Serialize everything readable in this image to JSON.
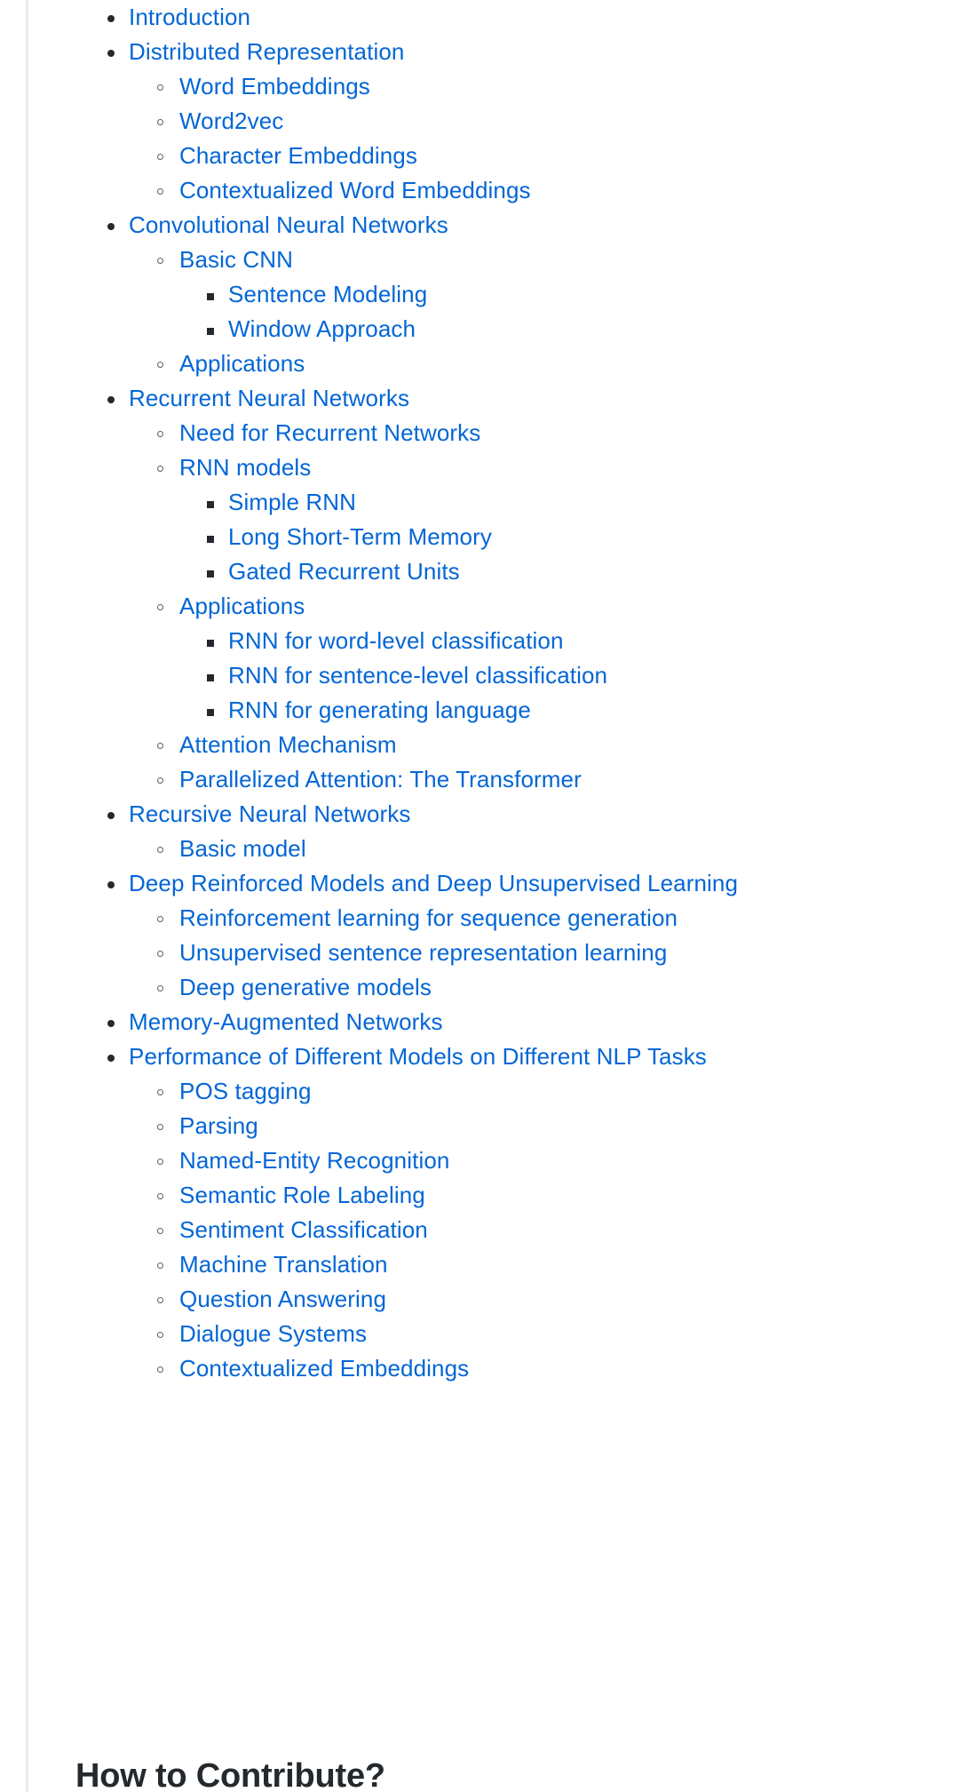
{
  "page": {
    "background_color": "#ffffff",
    "link_color": "#0366d6",
    "heading_color": "#24292e",
    "rule_color": "#eaecef"
  },
  "toc": {
    "items": [
      {
        "level": 1,
        "label": "Introduction",
        "bullet": "disc-bullet-icon"
      },
      {
        "level": 1,
        "label": "Distributed Representation",
        "bullet": "disc-bullet-icon"
      },
      {
        "level": 2,
        "label": "Word Embeddings",
        "bullet": "circle-bullet-icon"
      },
      {
        "level": 2,
        "label": "Word2vec",
        "bullet": "circle-bullet-icon"
      },
      {
        "level": 2,
        "label": "Character Embeddings",
        "bullet": "circle-bullet-icon"
      },
      {
        "level": 2,
        "label": "Contextualized Word Embeddings",
        "bullet": "circle-bullet-icon"
      },
      {
        "level": 1,
        "label": "Convolutional Neural Networks",
        "bullet": "disc-bullet-icon"
      },
      {
        "level": 2,
        "label": "Basic CNN",
        "bullet": "circle-bullet-icon"
      },
      {
        "level": 3,
        "label": "Sentence Modeling",
        "bullet": "square-bullet-icon"
      },
      {
        "level": 3,
        "label": "Window Approach",
        "bullet": "square-bullet-icon"
      },
      {
        "level": 2,
        "label": "Applications",
        "bullet": "circle-bullet-icon"
      },
      {
        "level": 1,
        "label": "Recurrent Neural Networks",
        "bullet": "disc-bullet-icon"
      },
      {
        "level": 2,
        "label": "Need for Recurrent Networks",
        "bullet": "circle-bullet-icon"
      },
      {
        "level": 2,
        "label": "RNN models",
        "bullet": "circle-bullet-icon"
      },
      {
        "level": 3,
        "label": "Simple RNN",
        "bullet": "square-bullet-icon"
      },
      {
        "level": 3,
        "label": "Long Short-Term Memory",
        "bullet": "square-bullet-icon"
      },
      {
        "level": 3,
        "label": "Gated Recurrent Units",
        "bullet": "square-bullet-icon"
      },
      {
        "level": 2,
        "label": "Applications",
        "bullet": "circle-bullet-icon"
      },
      {
        "level": 3,
        "label": "RNN for word-level classification",
        "bullet": "square-bullet-icon"
      },
      {
        "level": 3,
        "label": "RNN for sentence-level classification",
        "bullet": "square-bullet-icon"
      },
      {
        "level": 3,
        "label": "RNN for generating language",
        "bullet": "square-bullet-icon"
      },
      {
        "level": 2,
        "label": "Attention Mechanism",
        "bullet": "circle-bullet-icon"
      },
      {
        "level": 2,
        "label": "Parallelized Attention: The Transformer",
        "bullet": "circle-bullet-icon"
      },
      {
        "level": 1,
        "label": "Recursive Neural Networks",
        "bullet": "disc-bullet-icon"
      },
      {
        "level": 2,
        "label": "Basic model",
        "bullet": "circle-bullet-icon"
      },
      {
        "level": 1,
        "label": "Deep Reinforced Models and Deep Unsupervised Learning",
        "bullet": "disc-bullet-icon"
      },
      {
        "level": 2,
        "label": "Reinforcement learning for sequence generation",
        "bullet": "circle-bullet-icon"
      },
      {
        "level": 2,
        "label": "Unsupervised sentence representation learning",
        "bullet": "circle-bullet-icon"
      },
      {
        "level": 2,
        "label": "Deep generative models",
        "bullet": "circle-bullet-icon"
      },
      {
        "level": 1,
        "label": "Memory-Augmented Networks",
        "bullet": "disc-bullet-icon"
      },
      {
        "level": 1,
        "label": "Performance of Different Models on Different NLP Tasks",
        "bullet": "disc-bullet-icon"
      },
      {
        "level": 2,
        "label": "POS tagging",
        "bullet": "circle-bullet-icon"
      },
      {
        "level": 2,
        "label": "Parsing",
        "bullet": "circle-bullet-icon"
      },
      {
        "level": 2,
        "label": "Named-Entity Recognition",
        "bullet": "circle-bullet-icon"
      },
      {
        "level": 2,
        "label": "Semantic Role Labeling",
        "bullet": "circle-bullet-icon"
      },
      {
        "level": 2,
        "label": "Sentiment Classification",
        "bullet": "circle-bullet-icon"
      },
      {
        "level": 2,
        "label": "Machine Translation",
        "bullet": "circle-bullet-icon"
      },
      {
        "level": 2,
        "label": "Question Answering",
        "bullet": "circle-bullet-icon"
      },
      {
        "level": 2,
        "label": "Dialogue Systems",
        "bullet": "circle-bullet-icon"
      },
      {
        "level": 2,
        "label": "Contextualized Embeddings",
        "bullet": "circle-bullet-icon"
      }
    ]
  },
  "section_heading": {
    "text": "How to Contribute?"
  }
}
